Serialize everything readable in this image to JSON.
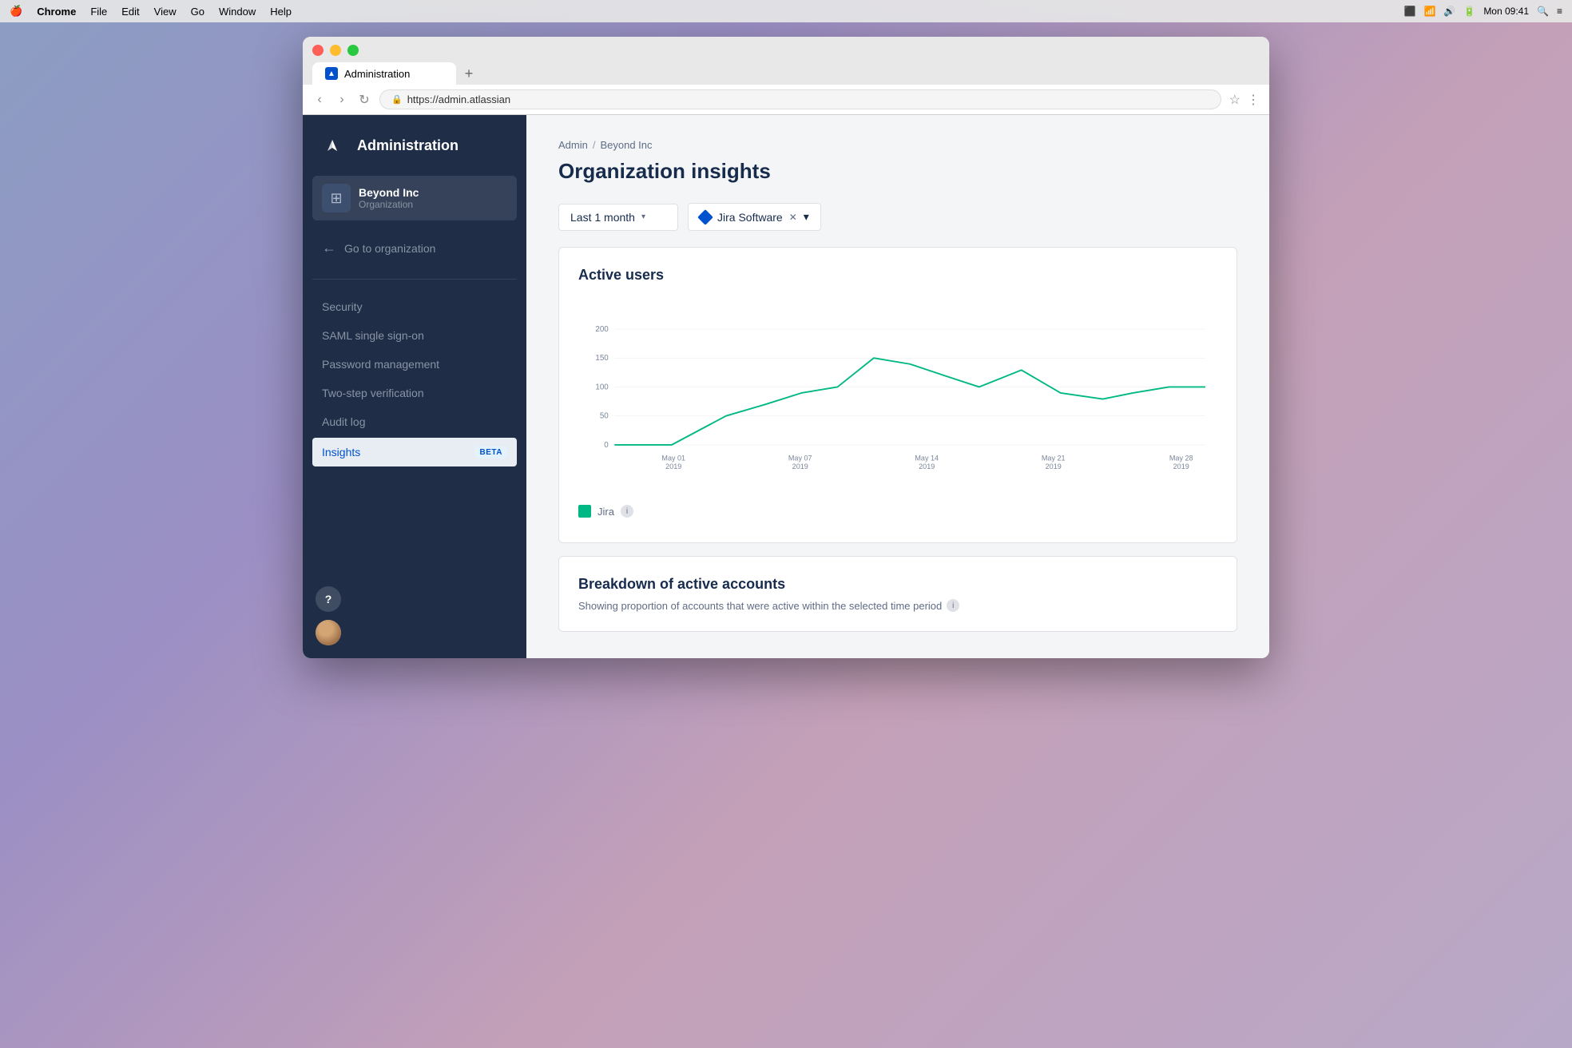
{
  "menubar": {
    "apple": "🍎",
    "app": "Chrome",
    "menus": [
      "File",
      "Edit",
      "View",
      "Go",
      "Window",
      "Help"
    ],
    "time": "Mon 09:41"
  },
  "browser": {
    "tab_title": "Administration",
    "url": "https://admin.atlassian"
  },
  "sidebar": {
    "title": "Administration",
    "org_name": "Beyond Inc",
    "org_type": "Organization",
    "go_to_org": "Go to organization",
    "nav_items": [
      {
        "label": "Security",
        "active": false
      },
      {
        "label": "SAML single sign-on",
        "active": false
      },
      {
        "label": "Password management",
        "active": false
      },
      {
        "label": "Two-step verification",
        "active": false
      },
      {
        "label": "Audit log",
        "active": false
      },
      {
        "label": "Insights",
        "active": true,
        "badge": "BETA"
      }
    ]
  },
  "breadcrumb": {
    "items": [
      "Admin",
      "Beyond Inc"
    ]
  },
  "page": {
    "title": "Organization insights",
    "filter_period": "Last 1 month",
    "filter_product": "Jira Software",
    "chart_title": "Active users",
    "y_labels": [
      "200",
      "150",
      "100",
      "50",
      "0"
    ],
    "x_labels": [
      {
        "date": "May 01",
        "year": "2019"
      },
      {
        "date": "May 07",
        "year": "2019"
      },
      {
        "date": "May 14",
        "year": "2019"
      },
      {
        "date": "May 21",
        "year": "2019"
      },
      {
        "date": "May 28",
        "year": "2019"
      }
    ],
    "legend_label": "Jira",
    "breakdown_title": "Breakdown of active accounts",
    "breakdown_subtitle": "Showing proportion of accounts that were active within the selected time period"
  }
}
